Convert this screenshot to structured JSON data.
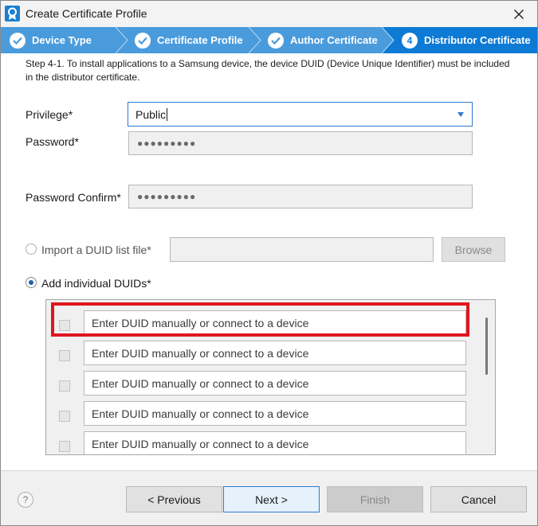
{
  "window": {
    "title": "Create Certificate Profile"
  },
  "steps": [
    {
      "label": "Device Type",
      "state": "done"
    },
    {
      "label": "Certificate Profile",
      "state": "done"
    },
    {
      "label": "Author Certificate",
      "state": "done"
    },
    {
      "label": "Distributor Certificate",
      "state": "active",
      "number": "4"
    }
  ],
  "description": "Step 4-1. To install applications to a Samsung device, the device DUID (Device Unique Identifier) must be included in the distributor certificate.",
  "form": {
    "privilege_label": "Privilege*",
    "privilege_value": "Public",
    "password_label": "Password*",
    "password_mask": "●●●●●●●●●",
    "password_confirm_label": "Password Confirm*",
    "password_confirm_mask": "●●●●●●●●●",
    "import_label": "Import a DUID list file*",
    "browse_label": "Browse",
    "add_label": "Add individual DUIDs*",
    "duid_placeholder": "Enter DUID manually or connect to a device",
    "duid_rows": 5
  },
  "footer": {
    "help_glyph": "?",
    "previous": "< Previous",
    "next": "Next >",
    "finish": "Finish",
    "cancel": "Cancel"
  },
  "colors": {
    "accent": "#4a9bdc",
    "active_step": "#0d7ad6",
    "highlight": "#e0161f"
  }
}
